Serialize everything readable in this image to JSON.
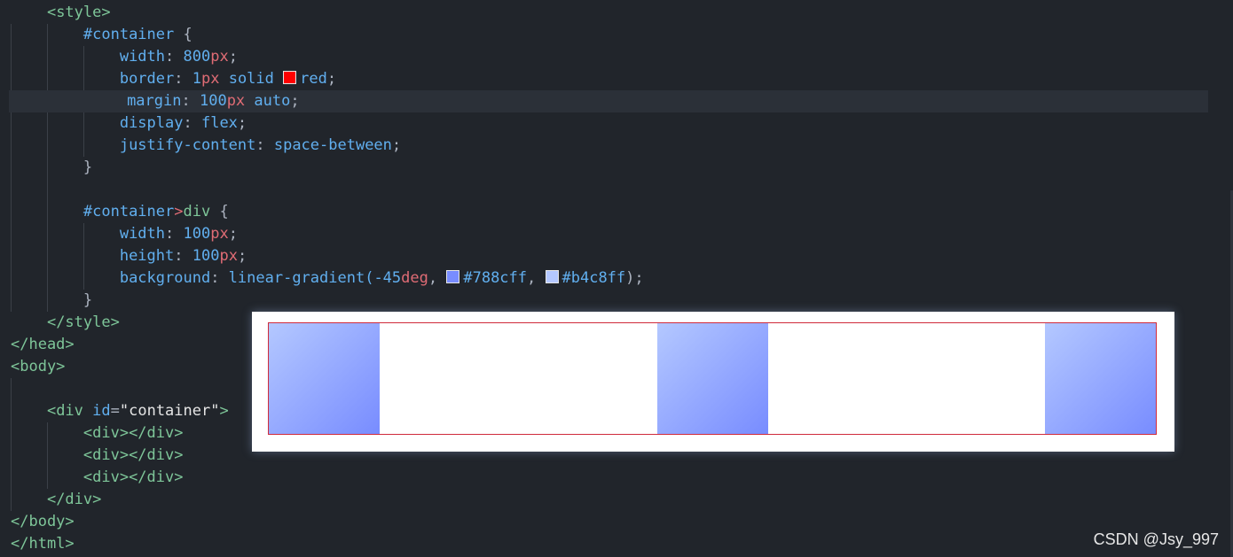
{
  "code": {
    "style_open": "<style>",
    "container_selector": "#container",
    "brace_open": "{",
    "brace_close": "}",
    "decl_width_800": {
      "prop": "width",
      "colon": ": ",
      "num": "800",
      "unit": "px",
      "semi": ";"
    },
    "decl_border": {
      "prop": "border",
      "colon": ": ",
      "num": "1",
      "unit": "px",
      "rest1": " solid ",
      "color_value": "red",
      "semi": ";"
    },
    "decl_margin": {
      "prop": "margin",
      "colon": ": ",
      "num": "100",
      "unit": "px",
      "rest": " auto",
      "semi": ";"
    },
    "decl_display": {
      "prop": "display",
      "colon": ": ",
      "val": "flex",
      "semi": ";"
    },
    "decl_justify": {
      "prop": "justify-content",
      "colon": ": ",
      "val": "space-between",
      "semi": ";"
    },
    "child_selector_a": "#container",
    "child_combinator": ">",
    "child_selector_b": "div",
    "decl_width_100": {
      "prop": "width",
      "colon": ": ",
      "num": "100",
      "unit": "px",
      "semi": ";"
    },
    "decl_height_100": {
      "prop": "height",
      "colon": ": ",
      "num": "100",
      "unit": "px",
      "semi": ";"
    },
    "decl_background": {
      "prop": "background",
      "colon": ": ",
      "fn": "linear-gradient(",
      "num": "-45",
      "unit": "deg",
      "sep": ", ",
      "color1": "#788cff",
      "color2": "#b4c8ff",
      "end": ");"
    },
    "style_close": "</style>",
    "head_close": "</head>",
    "body_open": "<body>",
    "div_open_tag": "<div",
    "div_attr_id": " id",
    "div_attr_eq": "=",
    "div_attr_value": "\"container\"",
    "div_open_end": ">",
    "child_div": "<div></div>",
    "div_close": "</div>",
    "body_close": "</body>",
    "html_close": "</html>"
  },
  "swatch_colors": {
    "red": "#ff0000",
    "color1": "#788cff",
    "color2": "#b4c8ff"
  },
  "preview": {
    "border_color": "red",
    "gradient": [
      "#788cff",
      "#b4c8ff"
    ]
  },
  "watermark": "CSDN @Jsy_997"
}
